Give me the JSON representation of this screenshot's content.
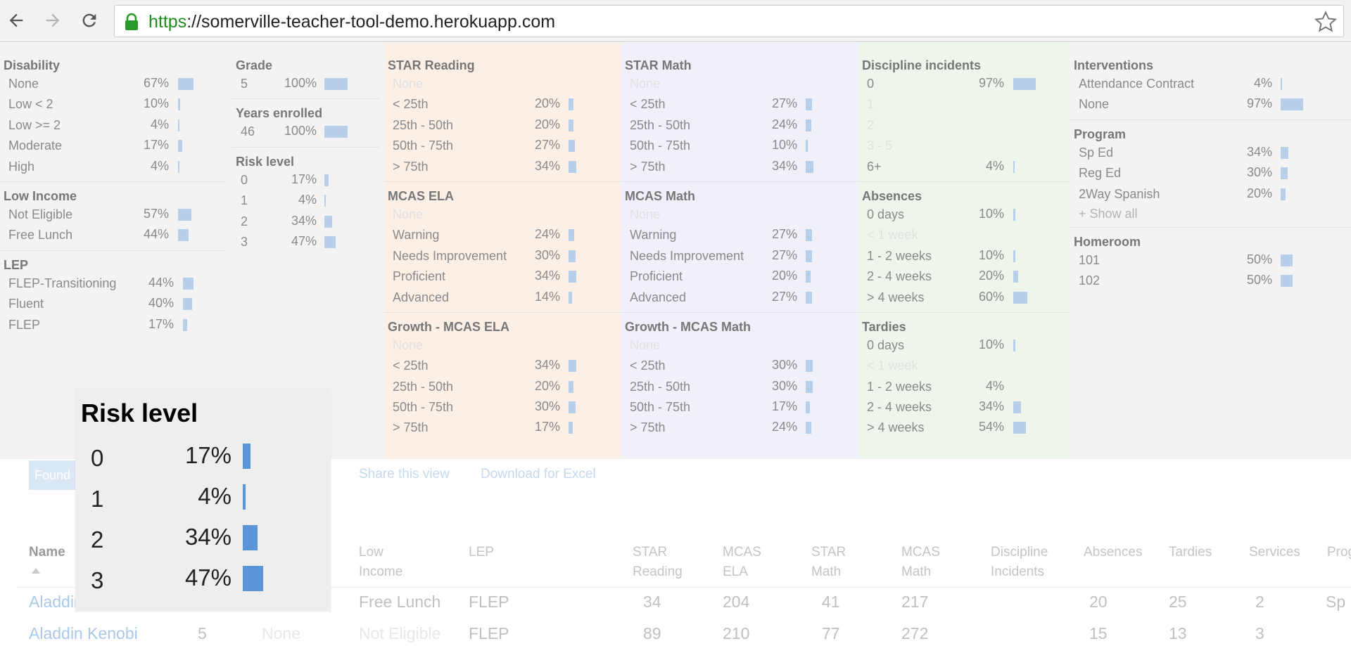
{
  "browser": {
    "url_scheme": "https",
    "url_rest": "://somerville-teacher-tool-demo.herokuapp.com"
  },
  "accent_colors": {
    "bar": "#b7cfe8",
    "zoom_bar": "#5b95d7",
    "scheme_green": "#1e8c1e"
  },
  "columns": [
    {
      "sections": [
        {
          "title": "Disability",
          "rows": [
            {
              "label": "None",
              "pct": "67%",
              "value": 67
            },
            {
              "label": "Low < 2",
              "pct": "10%",
              "value": 10
            },
            {
              "label": "Low >= 2",
              "pct": "4%",
              "value": 4
            },
            {
              "label": "Moderate",
              "pct": "17%",
              "value": 17
            },
            {
              "label": "High",
              "pct": "4%",
              "value": 4
            }
          ]
        },
        {
          "title": "Low Income",
          "rows": [
            {
              "label": "Not Eligible",
              "pct": "57%",
              "value": 57
            },
            {
              "label": "Free Lunch",
              "pct": "44%",
              "value": 44
            }
          ]
        },
        {
          "title": "LEP",
          "rows": [
            {
              "label": "FLEP-Transitioning",
              "pct": "44%",
              "value": 44
            },
            {
              "label": "Fluent",
              "pct": "40%",
              "value": 40
            },
            {
              "label": "FLEP",
              "pct": "17%",
              "value": 17
            }
          ]
        }
      ]
    },
    {
      "sections": [
        {
          "title": "Grade",
          "rows": [
            {
              "label": "5",
              "pct": "100%",
              "value": 100
            }
          ]
        },
        {
          "title": "Years enrolled",
          "rows": [
            {
              "label": "46",
              "pct": "100%",
              "value": 100
            }
          ]
        },
        {
          "title": "Risk level",
          "rows": [
            {
              "label": "0",
              "pct": "17%",
              "value": 17
            },
            {
              "label": "1",
              "pct": "4%",
              "value": 4
            },
            {
              "label": "2",
              "pct": "34%",
              "value": 34
            },
            {
              "label": "3",
              "pct": "47%",
              "value": 47
            }
          ]
        }
      ]
    },
    {
      "sections": [
        {
          "title": "STAR Reading",
          "rows": [
            {
              "label": "None",
              "faint": true
            },
            {
              "label": "< 25th",
              "pct": "20%",
              "value": 20
            },
            {
              "label": "25th - 50th",
              "pct": "20%",
              "value": 20
            },
            {
              "label": "50th - 75th",
              "pct": "27%",
              "value": 27
            },
            {
              "label": "> 75th",
              "pct": "34%",
              "value": 34
            }
          ]
        },
        {
          "title": "MCAS ELA",
          "rows": [
            {
              "label": "None",
              "faint": true
            },
            {
              "label": "Warning",
              "pct": "24%",
              "value": 24
            },
            {
              "label": "Needs Improvement",
              "pct": "30%",
              "value": 30
            },
            {
              "label": "Proficient",
              "pct": "34%",
              "value": 34
            },
            {
              "label": "Advanced",
              "pct": "14%",
              "value": 14
            }
          ]
        },
        {
          "title": "Growth - MCAS ELA",
          "rows": [
            {
              "label": "None",
              "faint": true
            },
            {
              "label": "< 25th",
              "pct": "34%",
              "value": 34
            },
            {
              "label": "25th - 50th",
              "pct": "20%",
              "value": 20
            },
            {
              "label": "50th - 75th",
              "pct": "30%",
              "value": 30
            },
            {
              "label": "> 75th",
              "pct": "17%",
              "value": 17
            }
          ]
        }
      ]
    },
    {
      "sections": [
        {
          "title": "STAR Math",
          "rows": [
            {
              "label": "None",
              "faint": true
            },
            {
              "label": "< 25th",
              "pct": "27%",
              "value": 27
            },
            {
              "label": "25th - 50th",
              "pct": "24%",
              "value": 24
            },
            {
              "label": "50th - 75th",
              "pct": "10%",
              "value": 10
            },
            {
              "label": "> 75th",
              "pct": "34%",
              "value": 34
            }
          ]
        },
        {
          "title": "MCAS Math",
          "rows": [
            {
              "label": "None",
              "faint": true
            },
            {
              "label": "Warning",
              "pct": "27%",
              "value": 27
            },
            {
              "label": "Needs Improvement",
              "pct": "27%",
              "value": 27
            },
            {
              "label": "Proficient",
              "pct": "20%",
              "value": 20
            },
            {
              "label": "Advanced",
              "pct": "27%",
              "value": 27
            }
          ]
        },
        {
          "title": "Growth - MCAS Math",
          "rows": [
            {
              "label": "None",
              "faint": true
            },
            {
              "label": "< 25th",
              "pct": "30%",
              "value": 30
            },
            {
              "label": "25th - 50th",
              "pct": "30%",
              "value": 30
            },
            {
              "label": "50th - 75th",
              "pct": "17%",
              "value": 17
            },
            {
              "label": "> 75th",
              "pct": "24%",
              "value": 24
            }
          ]
        }
      ]
    },
    {
      "sections": [
        {
          "title": "Discipline incidents",
          "rows": [
            {
              "label": "0",
              "pct": "97%",
              "value": 97
            },
            {
              "label": "1",
              "faint": true
            },
            {
              "label": "2",
              "faint": true
            },
            {
              "label": "3 - 5",
              "faint": true
            },
            {
              "label": "6+",
              "pct": "4%",
              "value": 4
            }
          ]
        },
        {
          "title": "Absences",
          "rows": [
            {
              "label": "0 days",
              "pct": "10%",
              "value": 10
            },
            {
              "label": "< 1 week",
              "faint": true
            },
            {
              "label": "1 - 2 weeks",
              "pct": "10%",
              "value": 10
            },
            {
              "label": "2 - 4 weeks",
              "pct": "20%",
              "value": 20
            },
            {
              "label": "> 4 weeks",
              "pct": "60%",
              "value": 60
            }
          ]
        },
        {
          "title": "Tardies",
          "rows": [
            {
              "label": "0 days",
              "pct": "10%",
              "value": 10
            },
            {
              "label": "< 1 week",
              "faint": true
            },
            {
              "label": "1 - 2 weeks",
              "pct": "4%",
              "value": 0
            },
            {
              "label": "2 - 4 weeks",
              "pct": "34%",
              "value": 34
            },
            {
              "label": "> 4 weeks",
              "pct": "54%",
              "value": 54
            }
          ]
        }
      ]
    },
    {
      "sections": [
        {
          "title": "Interventions",
          "rows": [
            {
              "label": "Attendance Contract",
              "pct": "4%",
              "value": 4
            },
            {
              "label": "None",
              "pct": "97%",
              "value": 97
            }
          ]
        },
        {
          "title": "Program",
          "rows": [
            {
              "label": "Sp Ed",
              "pct": "34%",
              "value": 34
            },
            {
              "label": "Reg Ed",
              "pct": "30%",
              "value": 30
            },
            {
              "label": "2Way Spanish",
              "pct": "20%",
              "value": 20
            }
          ],
          "show_all": "+ Show all"
        },
        {
          "title": "Homeroom",
          "rows": [
            {
              "label": "101",
              "pct": "50%",
              "value": 50
            },
            {
              "label": "102",
              "pct": "50%",
              "value": 50
            }
          ]
        }
      ]
    }
  ],
  "found_label": "Found",
  "links": {
    "share": "Share this view",
    "download": "Download for Excel"
  },
  "table": {
    "headers": [
      {
        "text": "Name",
        "sorted": true
      },
      {
        "text": "Low\nIncome"
      },
      {
        "text": "LEP"
      },
      {
        "text": "STAR\nReading"
      },
      {
        "text": "MCAS\nELA"
      },
      {
        "text": "STAR\nMath"
      },
      {
        "text": "MCAS\nMath"
      },
      {
        "text": "Discipline\nIncidents"
      },
      {
        "text": "Absences"
      },
      {
        "text": "Tardies"
      },
      {
        "text": "Services"
      },
      {
        "text": "Prog"
      }
    ],
    "rows": [
      {
        "name": "Aladdin",
        "grade": "",
        "disability": "",
        "low_income": "Free Lunch",
        "lep": "FLEP",
        "star_reading": "34",
        "mcas_ela": "204",
        "star_math": "41",
        "mcas_math": "217",
        "discipline": "",
        "absences": "20",
        "tardies": "25",
        "services": "2",
        "program": "Sp I"
      },
      {
        "name": "Aladdin Kenobi",
        "grade": "5",
        "disability": "None",
        "low_income": "Not Eligible",
        "lep": "FLEP",
        "star_reading": "89",
        "mcas_ela": "210",
        "star_math": "77",
        "mcas_math": "272",
        "discipline": "",
        "absences": "15",
        "tardies": "13",
        "services": "3",
        "program": ""
      }
    ]
  },
  "zoom": {
    "title": "Risk level",
    "rows": [
      {
        "label": "0",
        "pct": "17%",
        "value": 17
      },
      {
        "label": "1",
        "pct": "4%",
        "value": 4
      },
      {
        "label": "2",
        "pct": "34%",
        "value": 34
      },
      {
        "label": "3",
        "pct": "47%",
        "value": 47
      }
    ]
  }
}
